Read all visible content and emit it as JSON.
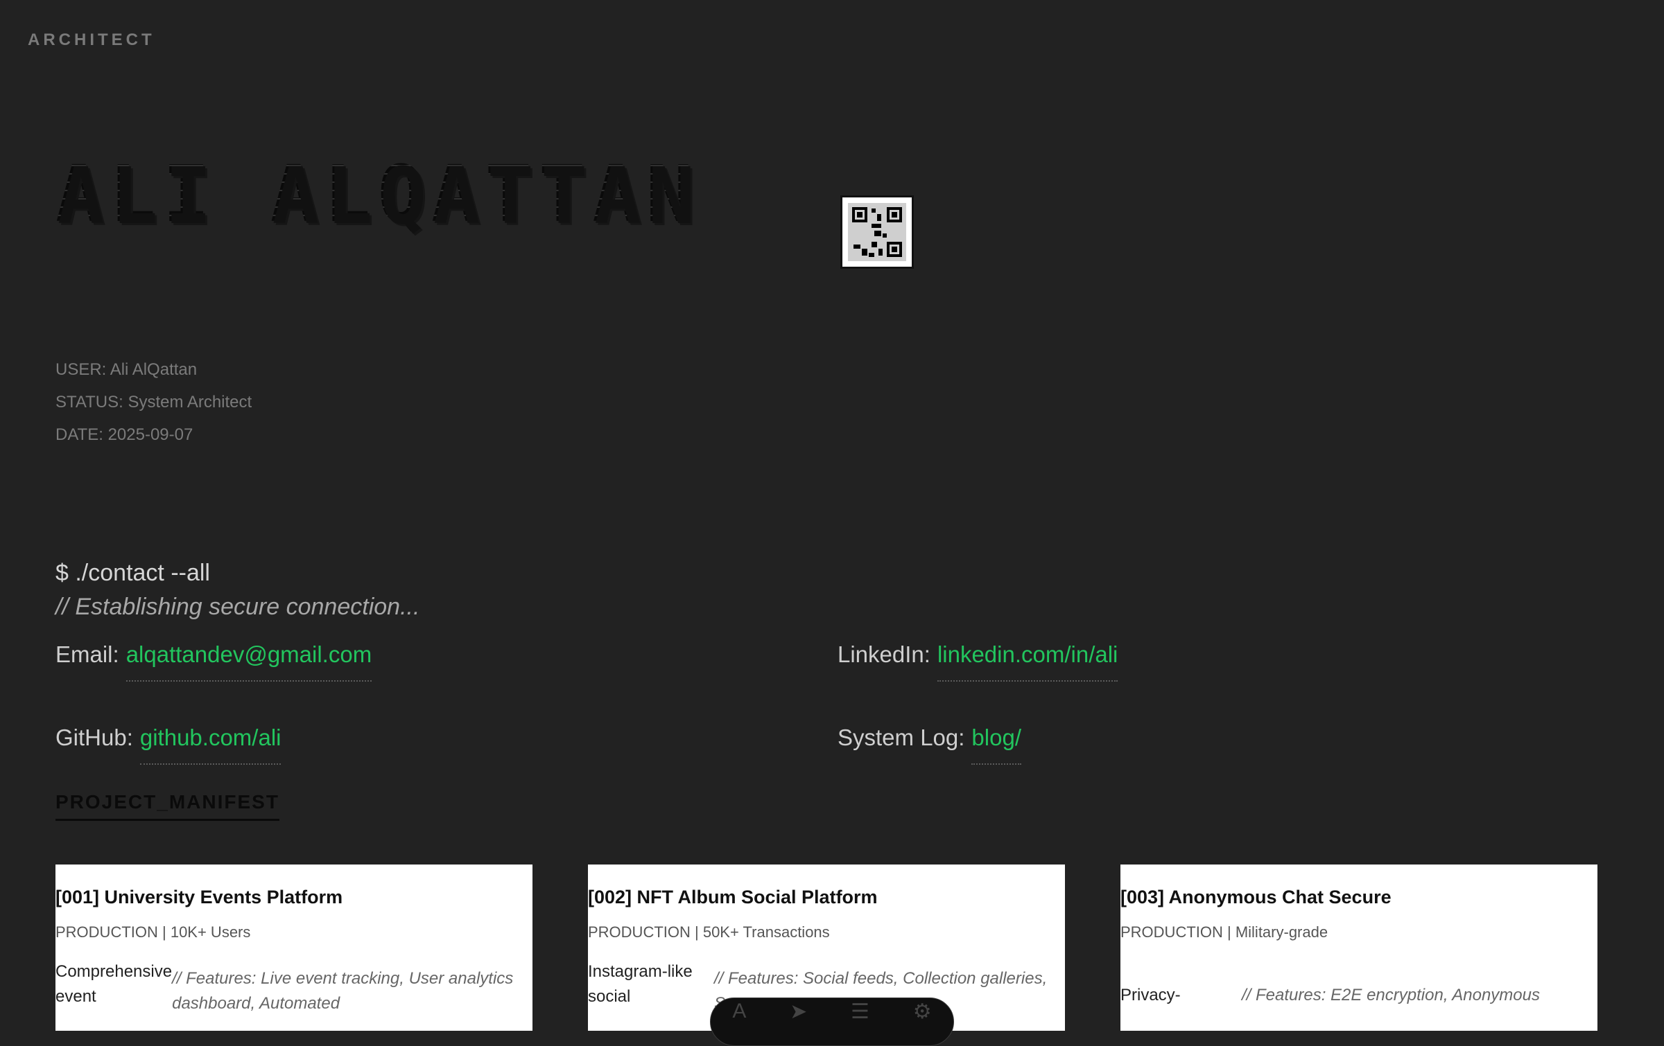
{
  "brand": "ARCHITECT",
  "hero": {
    "name": "ALI ALQATTAN"
  },
  "meta": [
    {
      "label": "USER:",
      "value": "Ali AlQattan"
    },
    {
      "label": "STATUS:",
      "value": "System Architect"
    },
    {
      "label": "DATE:",
      "value": "2025-09-07"
    }
  ],
  "contact": {
    "command": "$ ./contact --all",
    "comment": "// Establishing secure connection...",
    "email": {
      "label": "Email:",
      "value": "alqattandev@gmail.com"
    },
    "linkedin": {
      "label": "LinkedIn:",
      "value": "linkedin.com/in/ali"
    },
    "github": {
      "label": "GitHub:",
      "value": "github.com/ali"
    },
    "log": {
      "label": "System Log:",
      "value": "blog/"
    }
  },
  "manifest": {
    "title": "PROJECT_MANIFEST"
  },
  "projects": [
    {
      "title": "[001] University Events Platform",
      "status": "PRODUCTION | 10K+ Users",
      "desc": "Comprehensive event",
      "features": "// Features: Live event tracking, User analytics dashboard, Automated"
    },
    {
      "title": "[002] NFT Album Social Platform",
      "status": "PRODUCTION | 50K+ Transactions",
      "desc": "Instagram-like social",
      "features": "// Features: Social feeds, Collection galleries, Sec"
    },
    {
      "title": "[003] Anonymous Chat Secure",
      "status": "PRODUCTION | Military-grade",
      "desc": "Privacy-",
      "features": "// Features: E2E encryption, Anonymous"
    }
  ],
  "colors": {
    "background": "#222222",
    "link": "#22c55e",
    "card": "#ffffff"
  }
}
